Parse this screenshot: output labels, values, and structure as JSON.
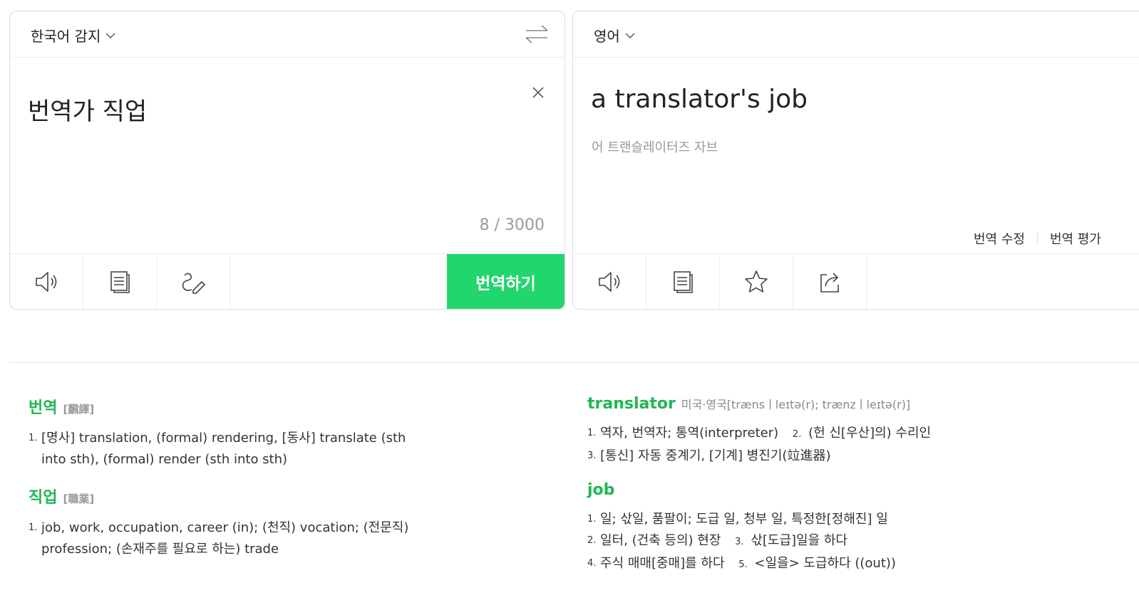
{
  "source": {
    "language": "한국어 감지",
    "text": "번역가 직업",
    "char_count": "8 / 3000",
    "translate_button": "번역하기",
    "tools": [
      "speaker-icon",
      "copy-icon",
      "handwriting-icon"
    ]
  },
  "target": {
    "language": "영어",
    "text": "a translator's job",
    "pronunciation": "어 트랜슬레이터즈 자브",
    "edit_label": "번역 수정",
    "rate_label": "번역 평가",
    "tools": [
      "speaker-icon",
      "copy-icon",
      "star-icon",
      "share-icon"
    ]
  },
  "dict_left": [
    {
      "word": "번역",
      "hanja": "[飜譯]",
      "senses": [
        {
          "num": "1.",
          "text": "[명사] translation, (formal) rendering, [동사] translate (sth into sth), (formal) render (sth into sth)"
        }
      ]
    },
    {
      "word": "직업",
      "hanja": "[職業]",
      "senses": [
        {
          "num": "1.",
          "text": "job, work, occupation, career (in); (천직) vocation; (전문직) profession; (손재주를 필요로 하는) trade"
        }
      ]
    }
  ],
  "dict_right": [
    {
      "word": "translator",
      "phonetic": "미국·영국[trænsㅣleɪtə(r); trænzㅣleɪtə(r)]",
      "lines": [
        [
          {
            "num": "1.",
            "text": "역자, 번역자; 통역(interpreter)"
          },
          {
            "num": "2.",
            "text": "(헌 신[우산]의) 수리인"
          }
        ],
        [
          {
            "num": "3.",
            "text": "[통신] 자동 중계기, [기계] 병진기(竝進器)"
          }
        ]
      ]
    },
    {
      "word": "job",
      "lines": [
        [
          {
            "num": "1.",
            "text": "일; 삯일, 품팔이; 도급 일, 청부 일, 특정한[정해진] 일"
          }
        ],
        [
          {
            "num": "2.",
            "text": "일터, (건축 등의) 현장"
          },
          {
            "num": "3.",
            "text": "삯[도급]일을 하다"
          }
        ],
        [
          {
            "num": "4.",
            "text": "주식 매매[중매]를 하다"
          },
          {
            "num": "5.",
            "text": "<일을> 도급하다 ((out))"
          }
        ]
      ]
    }
  ],
  "colors": {
    "accent": "#22d66e",
    "headword": "#1fb752"
  }
}
